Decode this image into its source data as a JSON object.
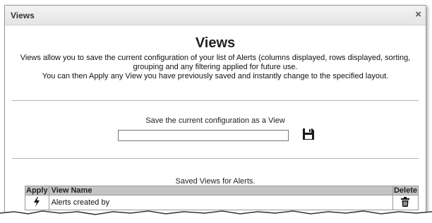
{
  "dialog": {
    "title": "Views",
    "close_glyph": "×",
    "heading": "Views",
    "description_line1": "Views allow you to save the current configuration of your list of Alerts (columns displayed, rows displayed, sorting, grouping and any filtering applied for future use.",
    "description_line2": "You can then Apply any View you have previously saved and instantly change to the specified layout."
  },
  "save": {
    "label": "Save the current configuration as a View",
    "input_value": "",
    "icon": "floppy-disk-icon"
  },
  "saved_views": {
    "label": "Saved Views for Alerts.",
    "columns": [
      "Apply",
      "View Name",
      "Delete"
    ],
    "rows": [
      {
        "view_name": "Alerts created by",
        "apply_icon": "lightning-bolt-icon",
        "delete_icon": "trash-icon"
      }
    ]
  },
  "colors": {
    "header_bg": "#c4c4c4",
    "titlebar_bg": "#e8e8e8",
    "border": "#9a9a9a"
  }
}
